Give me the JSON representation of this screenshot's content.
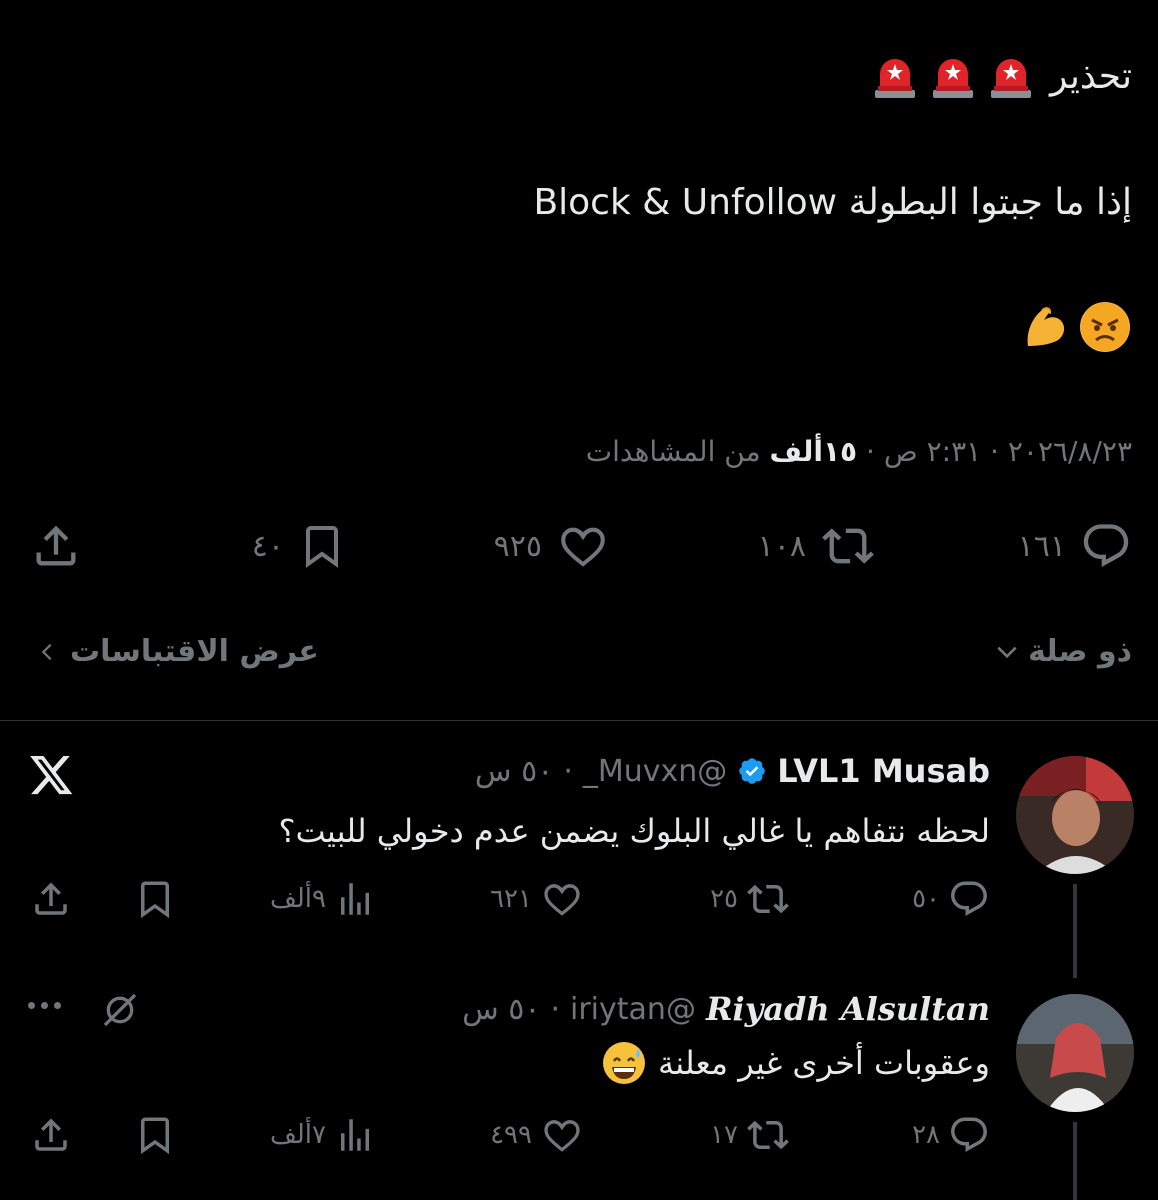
{
  "colors": {
    "bg": "#000000",
    "text": "#e7e9ea",
    "muted": "#71767b",
    "verified": "#1d9bf0",
    "divider": "#2f3336"
  },
  "tweet": {
    "line1": "تحذير",
    "siren_emojis": [
      "police-light-emoji",
      "police-light-emoji",
      "police-light-emoji"
    ],
    "line2": "إذا ما جبتوا البطولة Block & Unfollow",
    "line3_emojis": [
      "angry-face-emoji",
      "flexed-biceps-emoji"
    ],
    "meta_date": "٢٠٢٦/٨/٢٣ · ٢:٣١ ص · ",
    "meta_views_num": "١٥ألف",
    "meta_views_label": " من المشاهدات",
    "actions": {
      "replies": "١٦١",
      "retweets": "١٠٨",
      "likes": "٩٢٥",
      "bookmarks": "٤٠"
    },
    "relevance": "ذو صلة",
    "view_quotes": "عرض الاقتباسات"
  },
  "replies": [
    {
      "name": "LVL1 Musab",
      "handle": "@Muvxn_",
      "time": "٥٠ س",
      "text": "لحظه نتفاهم يا غالي البلوك يضمن عدم دخولي للبيت؟",
      "replies": "٥٠",
      "retweets": "٢٥",
      "likes": "٦٢١",
      "views": "٩ألف"
    },
    {
      "name": "𝑹𝒊𝒚𝒂𝒅𝒉 𝑨𝒍𝒔𝒖𝒍𝒕𝒂𝒏",
      "handle": "@iriytan",
      "time": "٥٠ س",
      "text": "وعقوبات أخرى غير معلنة",
      "replies": "٢٨",
      "retweets": "١٧",
      "likes": "٤٩٩",
      "views": "٧ألف"
    }
  ]
}
